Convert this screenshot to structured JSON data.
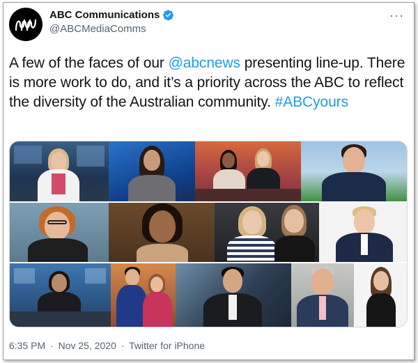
{
  "account": {
    "display_name": "ABC Communications",
    "handle": "@ABCMediaComms",
    "verified": true,
    "avatar_icon": "abc-logo-icon"
  },
  "more_icon": "more-icon",
  "tweet": {
    "text_before_mention": "A few of the faces of our ",
    "mention": "@abcnews",
    "text_after_mention": " presenting line-up. There is more work to do, and it’s a priority across the ABC to reflect the diversity of the Australian community. ",
    "hashtag": "#ABCyours"
  },
  "meta": {
    "time": "6:35 PM",
    "separator": "·",
    "date": "Nov 25, 2020",
    "source": "Twitter for iPhone"
  },
  "colors": {
    "link": "#1d9bf0",
    "verified_badge": "#1d9bf0",
    "secondary_text": "#536471"
  }
}
